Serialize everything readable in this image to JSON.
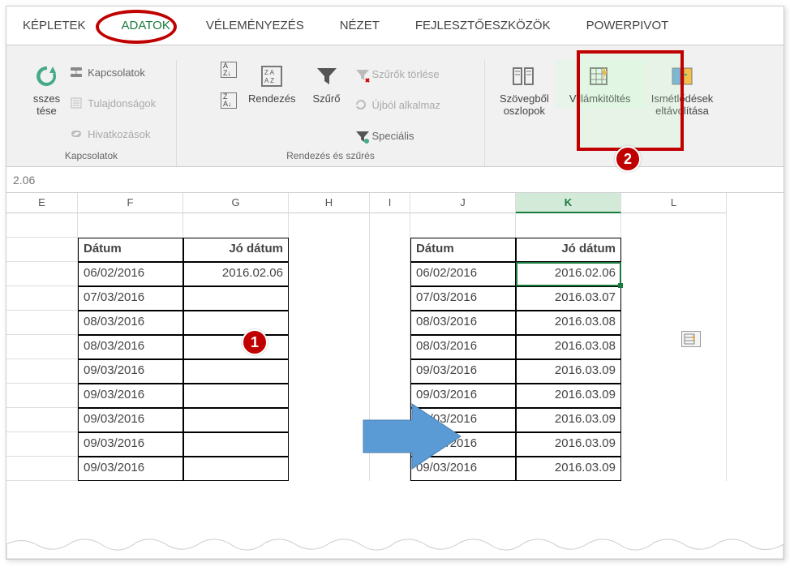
{
  "tabs": {
    "kepletek": "KÉPLETEK",
    "adatok": "ADATOK",
    "velemenyezes": "VÉLEMÉNYEZÉS",
    "nezet": "NÉZET",
    "fejlesztoeszkozok": "FEJLESZTŐESZKÖZÖK",
    "powerpivot": "POWERPIVOT"
  },
  "ribbon": {
    "refresh_partial": "sszes",
    "refresh_partial2": "tése",
    "kapcsolatok": "Kapcsolatok",
    "tulajdonsagok": "Tulajdonságok",
    "hivatkozasok": "Hivatkozások",
    "kapcsolatok_group": "Kapcsolatok",
    "rendezes": "Rendezés",
    "szuro": "Szűrő",
    "szurok_torlese": "Szűrők törlése",
    "ujbol_alkalmaz": "Újból alkalmaz",
    "specialis": "Speciális",
    "rendezes_group": "Rendezés és szűrés",
    "szovegbol1": "Szövegből",
    "szovegbol2": "oszlopok",
    "villamkitoltes": "Villámkitöltés",
    "ismetlodesek1": "Ismétlődések",
    "ismetlodesek2": "eltávolítása"
  },
  "formula": "2.06",
  "columns": {
    "E": "E",
    "F": "F",
    "G": "G",
    "H": "H",
    "I": "I",
    "J": "J",
    "K": "K",
    "L": "L"
  },
  "headers": {
    "datum": "Dátum",
    "jo_datum": "Jó dátum"
  },
  "left_table": {
    "g_first": "2016.02.06",
    "f": [
      "06/02/2016",
      "07/03/2016",
      "08/03/2016",
      "08/03/2016",
      "09/03/2016",
      "09/03/2016",
      "09/03/2016",
      "09/03/2016",
      "09/03/2016"
    ]
  },
  "right_table": {
    "j": [
      "06/02/2016",
      "07/03/2016",
      "08/03/2016",
      "08/03/2016",
      "09/03/2016",
      "09/03/2016",
      "09/03/2016",
      "09/03/2016",
      "09/03/2016"
    ],
    "k": [
      "2016.02.06",
      "2016.03.07",
      "2016.03.08",
      "2016.03.08",
      "2016.03.09",
      "2016.03.09",
      "2016.03.09",
      "2016.03.09",
      "2016.03.09"
    ]
  },
  "badges": {
    "one": "1",
    "two": "2"
  }
}
